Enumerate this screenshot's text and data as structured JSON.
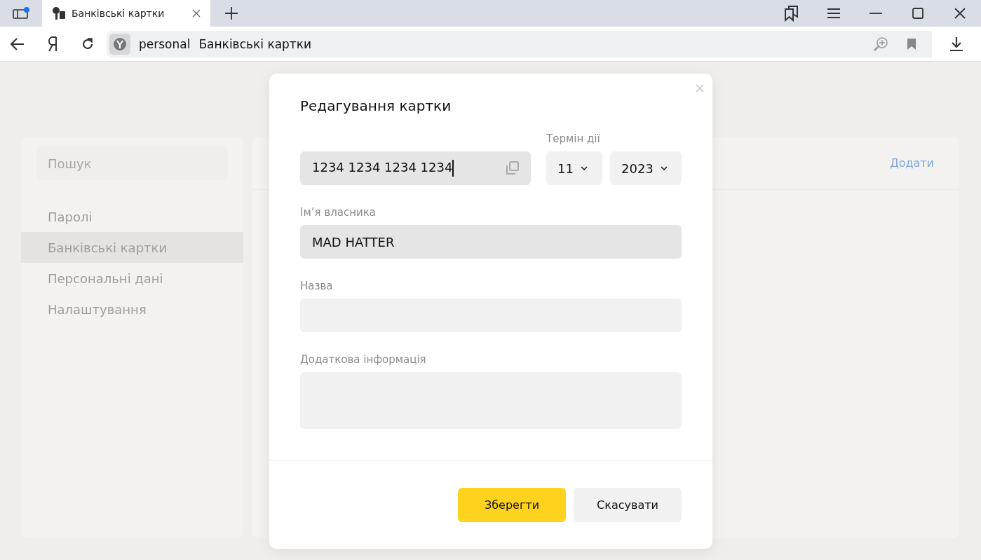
{
  "browser": {
    "tabs": [
      {
        "title": "Банківські картки",
        "selected": true
      }
    ],
    "address": {
      "host": "personal",
      "page_title": "Банківські картки"
    }
  },
  "sidebar": {
    "search": {
      "placeholder": "Пошук"
    },
    "items": [
      {
        "label": "Паролі",
        "selected": false
      },
      {
        "label": "Банківські картки",
        "selected": true
      },
      {
        "label": "Персональні дані",
        "selected": false
      },
      {
        "label": "Налаштування",
        "selected": false
      }
    ]
  },
  "main": {
    "add_link": "Додати"
  },
  "dialog": {
    "title": "Редагування картки",
    "card_number": {
      "value": "1234 1234 1234 1234",
      "focused": true
    },
    "expiry": {
      "label": "Термін дії",
      "month": "11",
      "year": "2023"
    },
    "fields": [
      {
        "label": "Ім’я власника",
        "value": "MAD HATTER",
        "kind": "input",
        "filled": true
      },
      {
        "label": "Назва",
        "kind": "input",
        "filled": false
      },
      {
        "label": "Додаткова інформація",
        "kind": "textarea",
        "filled": false
      }
    ],
    "buttons": [
      {
        "label": "Зберегти",
        "kind": "primary"
      },
      {
        "label": "Скасувати",
        "kind": "secondary"
      }
    ]
  }
}
